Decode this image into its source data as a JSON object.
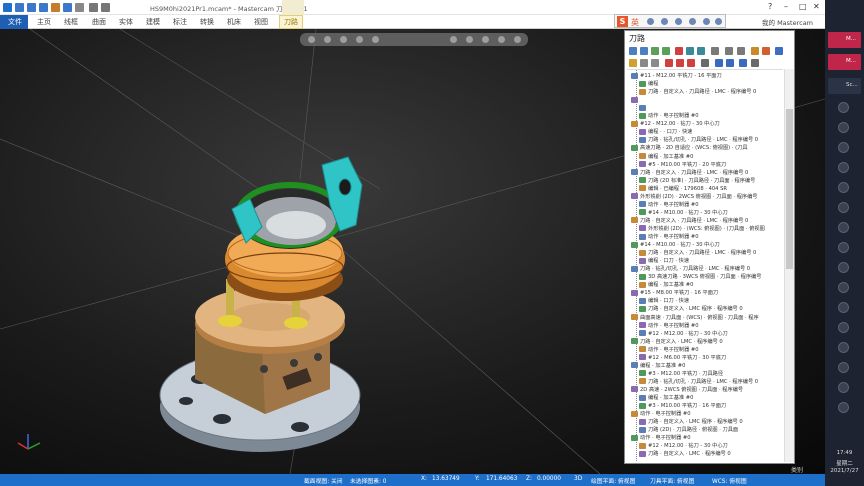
{
  "window": {
    "title": "HS9M0hi2021Pr1.mcam* - Mastercam 刀具 2021"
  },
  "menubar": {
    "tabs": [
      "文件",
      "主页",
      "线框",
      "曲面",
      "实体",
      "建模",
      "标注",
      "转换",
      "机床",
      "视图",
      "刀路"
    ],
    "active": "刀路"
  },
  "ime": {
    "lang": "英"
  },
  "login": "我的 Mastercam",
  "panel": {
    "title": "刀路",
    "rows": [
      "#11 - M12.00 平铣刀 - 16 平面刀",
      "编程",
      "刀路 · 自定义入 · 刀具路径 · LMC · 程序编号 0",
      "",
      "",
      "动作 · 电子控制器 #0",
      "#12 - M12.00 · 钻刀 - 30 中心刀",
      "编程 · · 口刀 · 快速",
      "刀路 · 钻孔/切孔 · 刀具路径 · LMC · 程序编号 0",
      "高速刀路 · 2D 自适应 · (WCS: 俯视图) · (刀具",
      "编程 · 加工基准 #0",
      "#5 - M10.00 平铣刀 · 20 平底刀",
      "刀路 · 自定义入 · 刀具路径 · LMC · 程序编号 0",
      "刀路 (2D 标准) · 刀具路径 · 刀具面 · 程序编号",
      "编辑 · 已编程 · 179608 · 404 SR",
      "外形铣削 (2D) · 2WCS 俯视图 · 刀具面 · 程序编号",
      "动作 · 电子控制器 #0",
      "#14 - M10.00 · 钻刀 - 30 中心刀",
      "刀路 · 自定义入 · 刀具路径 · LMC · 程序编号 0",
      "外形铣削 (2D) · (WCS: 俯视图) · (刀具面 · 俯视图",
      "动作 · 电子控制器 #0",
      "#14 - M10.00 · 钻刀 - 30 中心刀",
      "刀路 · 自定义入 · 刀具路径 · LMC · 程序编号 0",
      "编程 · 口刀 · 快速",
      "刀路 · 钻孔/切孔 · 刀具路径 · LMC · 程序编号 0",
      "3D 高速刀路 · 3WCS 俯视图 · 刀具面 · 程序编号",
      "编程 · 加工基准 #0",
      "#15 - M8.00 平铣刀 · 16 平面刀",
      "编辑 · 口刀 · 快速",
      "刀路 · 自定义入 · LMC 程序 · 程序编号 0",
      "曲面高速 · 刀具面 · (WCS) · 俯视图 · 刀具面 · 程序",
      "动作 · 电子控制器 #0",
      "#12 - M12.00 · 钻刀 - 30 中心刀",
      "刀路 · 自定义入 · LMC · 程序编号 0",
      "动作 · 电子控制器 #0",
      "#12 - M6.00 平铣刀 · 30 平底刀",
      "编程 · 加工基准 #0",
      "#3 - M12.00 平铣刀 · 刀具路径",
      "刀路 · 钻孔/切孔 · 刀具路径 · LMC · 程序编号 0",
      "2D 高速 · 2WCS 俯视图 · 刀具面 · 程序编号",
      "编程 · 加工基准 #0",
      "#3 - M10.00 平铣刀 · 16 平面刀",
      "动作 · 电子控制器 #0",
      "刀路 · 自定义入 · LMC 程序 · 程序编号 0",
      "刀路 (2D) · 刀具路径 · 俯视图 · 刀具面",
      "动作 · 电子控制器 #0",
      "#12 - M12.00 · 钻刀 - 30 中心刀",
      "刀路 · 自定义入 · LMC · 程序编号 0"
    ],
    "footer": "类别"
  },
  "statusbar": {
    "section": "截面视图: 关闭",
    "selected": "未选择图素: 0",
    "x_label": "X:",
    "x_value": "13.63749",
    "y_label": "Y:",
    "y_value": "171.64063",
    "z_label": "Z:",
    "z_value": "0.00000",
    "mode": "3D",
    "view": "绘图平面: 俯视图",
    "tool_plane": "刀具平面: 俯视图",
    "wcs": "WCS: 俯视图"
  },
  "taskbar": {
    "apps": [
      "M...",
      "M...",
      "Sc..."
    ],
    "time": "17:49",
    "day": "星期二",
    "date": "2021/7/27"
  },
  "colors": {
    "accent": "#1d6fc9",
    "turquoise": "#2fc4c6",
    "copper": "#d98a2f",
    "green_ring": "#1f8f1f",
    "brass": "#c9b24a"
  }
}
